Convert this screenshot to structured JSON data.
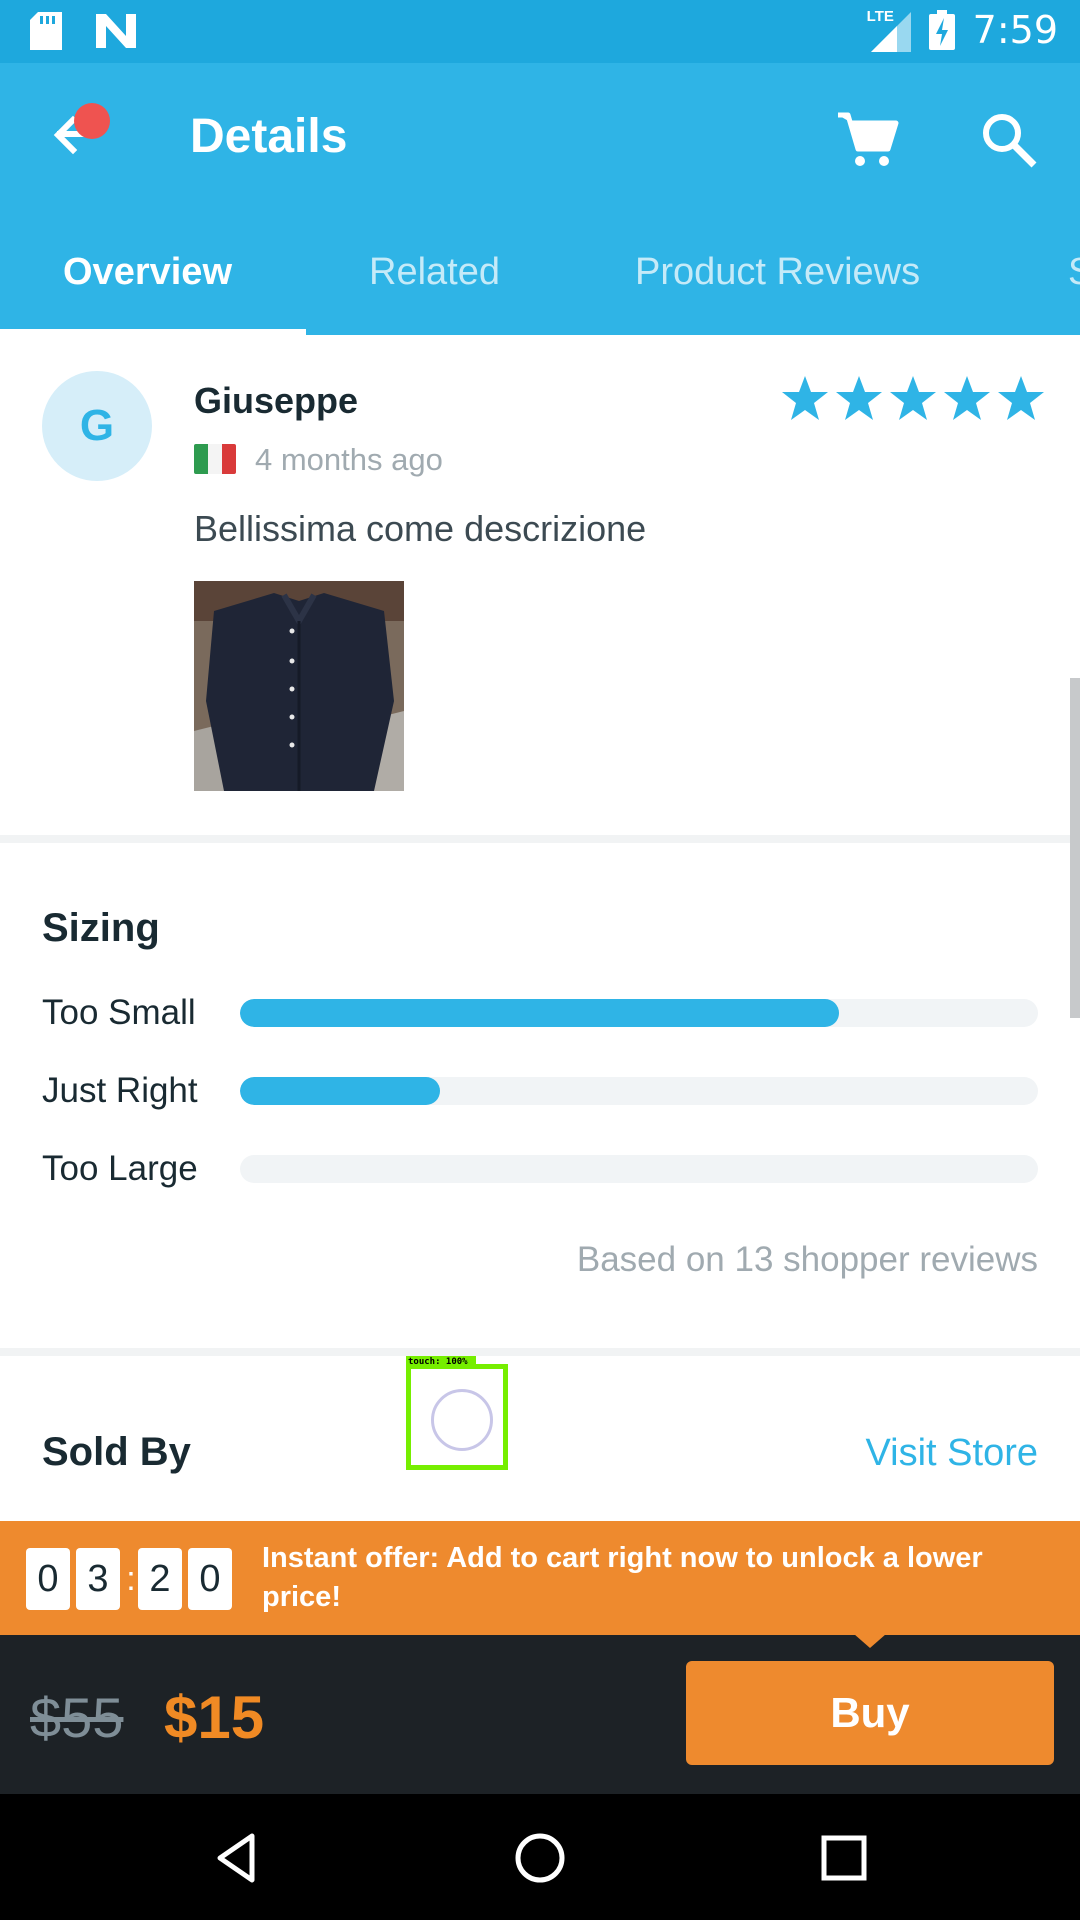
{
  "status_bar": {
    "time": "7:59",
    "network": "LTE",
    "icons": [
      "sd-card-icon",
      "n-app-icon",
      "signal-icon",
      "battery-charging-icon"
    ]
  },
  "app_bar": {
    "title": "Details",
    "icons": [
      "back-arrow-icon",
      "cart-icon",
      "search-icon"
    ],
    "colors": {
      "primary": "#2fb4e6",
      "notification": "#ef5350"
    }
  },
  "tabs": [
    {
      "label": "Overview",
      "active": true
    },
    {
      "label": "Related",
      "active": false
    },
    {
      "label": "Product Reviews",
      "active": false
    },
    {
      "label": "S",
      "active": false
    }
  ],
  "review": {
    "avatar_initial": "G",
    "name": "Giuseppe",
    "country_flag": "italy-flag",
    "time_ago": "4 months ago",
    "rating": 5,
    "text": "Bellissima come descrizione"
  },
  "sizing": {
    "title": "Sizing",
    "rows": [
      {
        "label": "Too Small",
        "fraction": 0.75
      },
      {
        "label": "Just Right",
        "fraction": 0.25
      },
      {
        "label": "Too Large",
        "fraction": 0.0
      }
    ],
    "note": "Based on 13 shopper reviews"
  },
  "sold_by": {
    "title": "Sold By",
    "link": "Visit Store"
  },
  "touch_indicator": {
    "label": "touch: 100%"
  },
  "offer": {
    "timer": {
      "d1": "0",
      "d2": "3",
      "sep": ":",
      "d3": "2",
      "d4": "0"
    },
    "text": "Instant offer: Add to cart right now to unlock a lower price!"
  },
  "buy_bar": {
    "old_price": "$55",
    "price": "$15",
    "button": "Buy",
    "accent": "#ee8a2e"
  },
  "nav_bar": {
    "icons": [
      "nav-back-icon",
      "nav-home-icon",
      "nav-recents-icon"
    ]
  }
}
